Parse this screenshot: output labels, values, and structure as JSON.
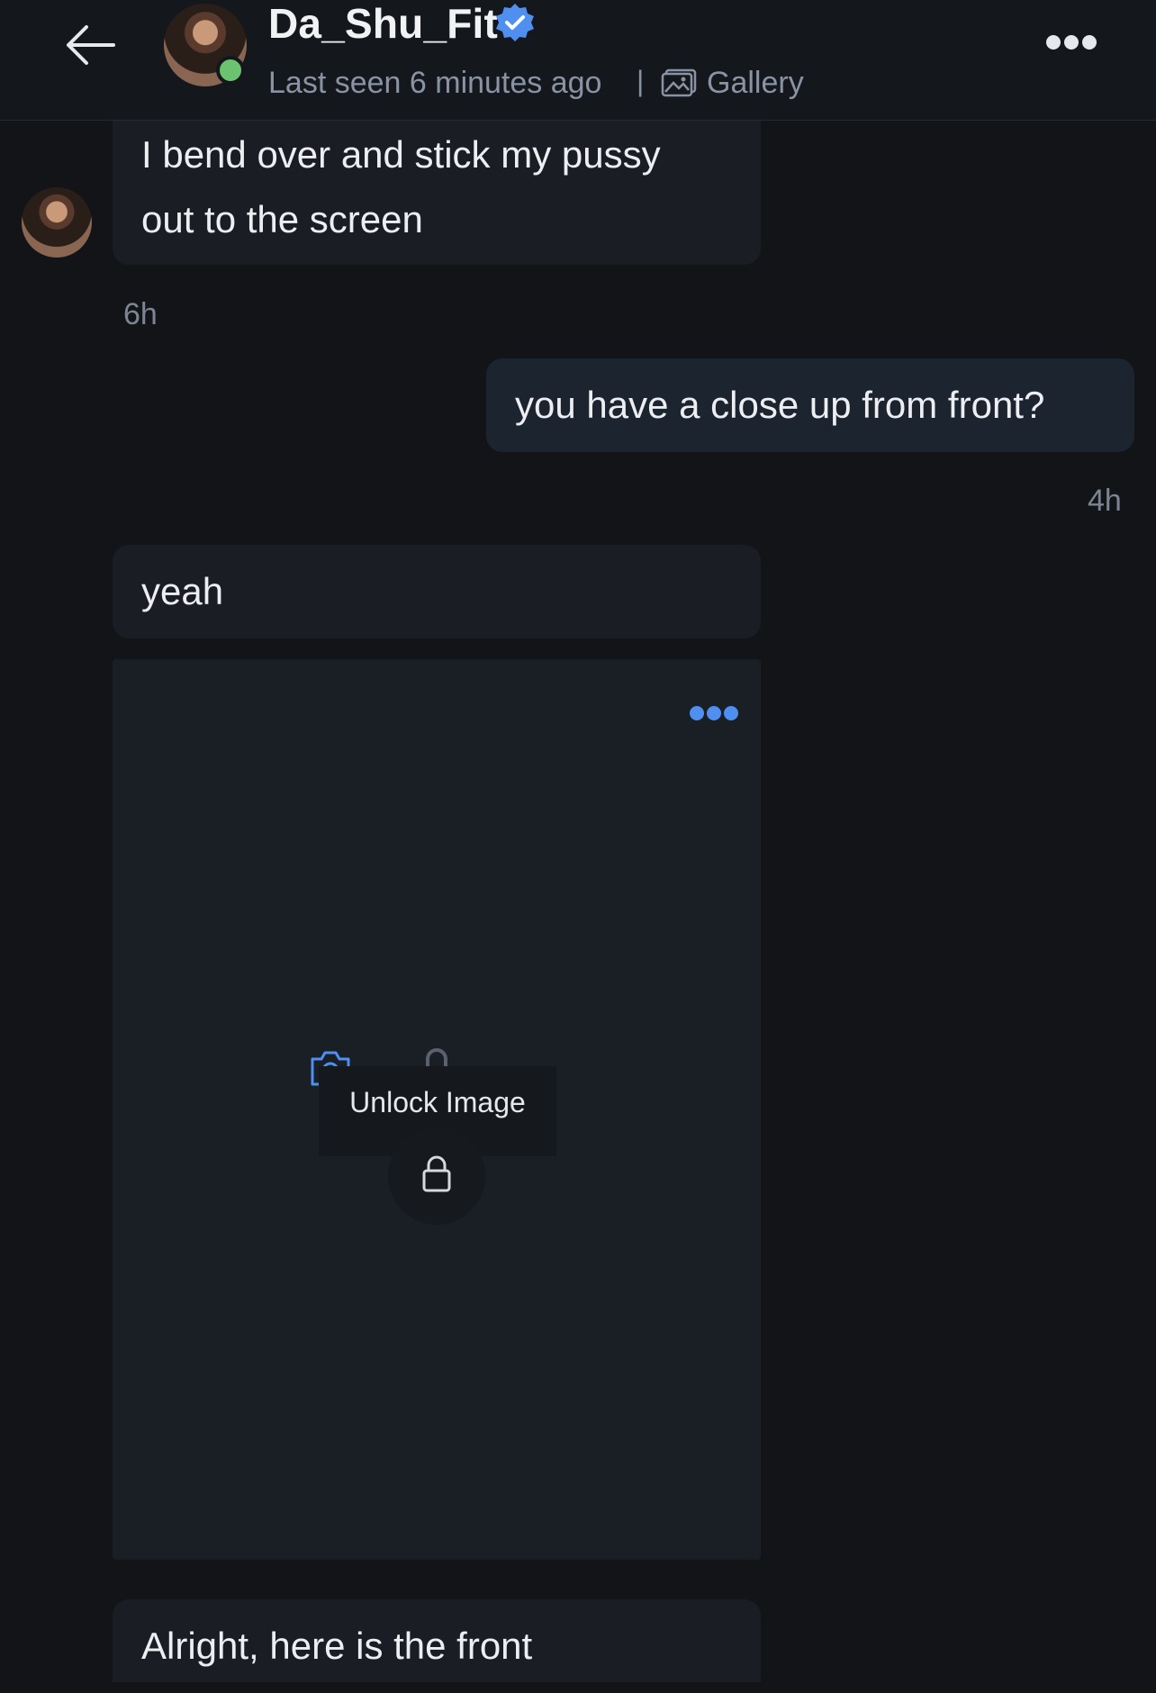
{
  "header": {
    "name": "Da_Shu_Fit",
    "status": "Last seen 6 minutes ago",
    "separator": "|",
    "gallery_label": "Gallery"
  },
  "messages": {
    "m1": {
      "line1": "I bend over and stick my pussy",
      "line2": "out to the screen",
      "time": "6h"
    },
    "m2": {
      "text": "you have a close up from front?",
      "time": "4h"
    },
    "m3": {
      "text": "yeah"
    },
    "media": {
      "unlock_label": "Unlock Image"
    },
    "m4": {
      "text": "Alright, here is the front"
    }
  },
  "colors": {
    "accent": "#4f8ff0",
    "online": "#6cc36f",
    "background": "#121418"
  }
}
